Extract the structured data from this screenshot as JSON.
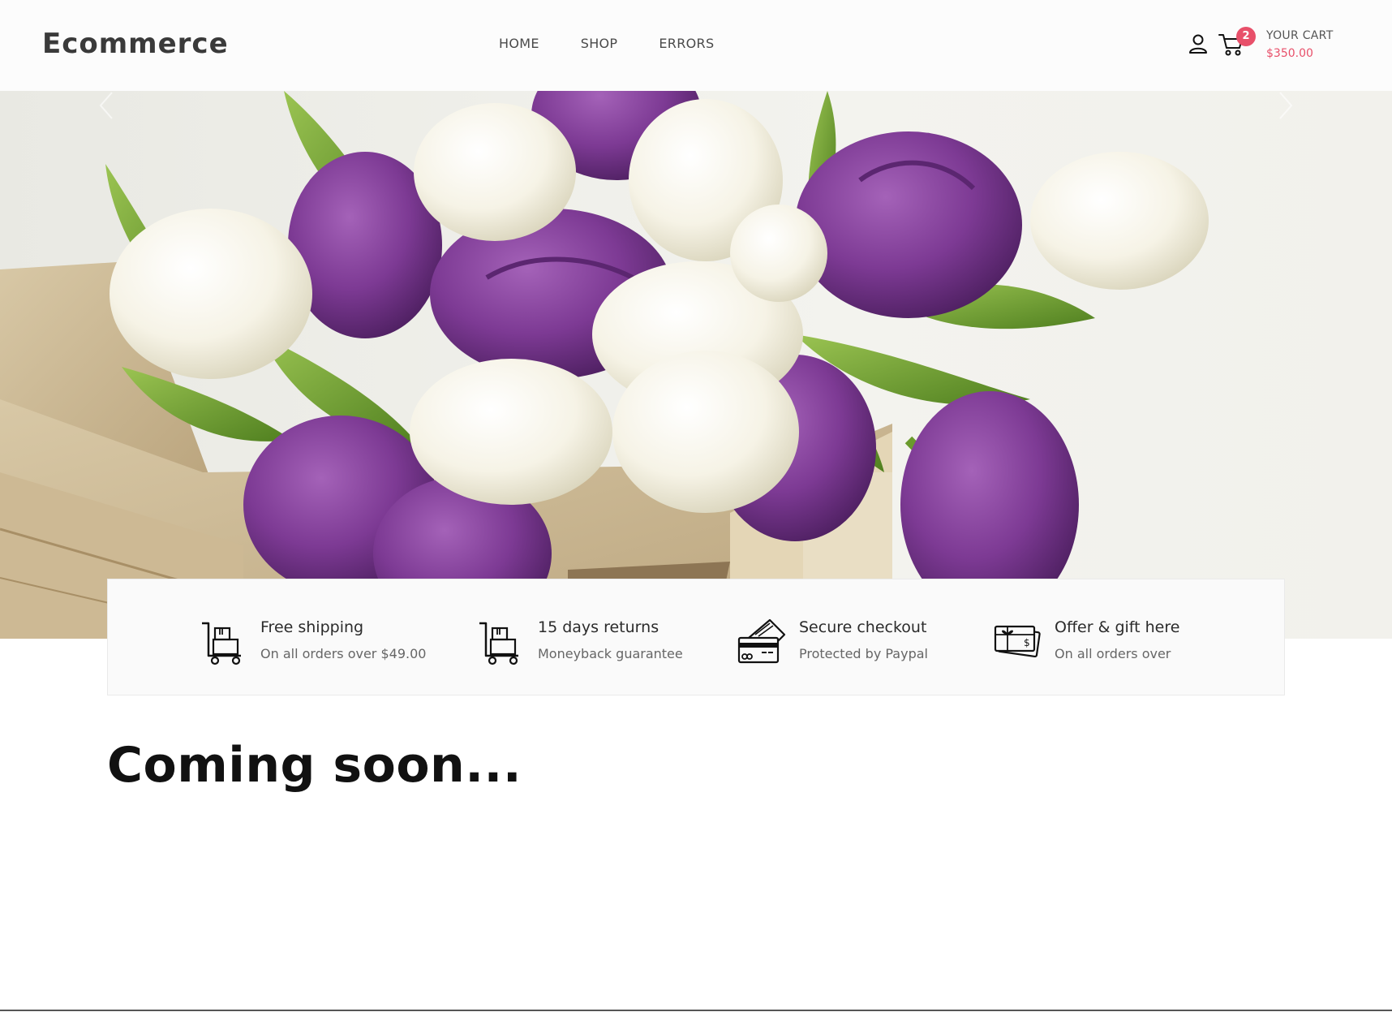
{
  "header": {
    "logo": "Ecommerce",
    "nav": [
      "HOME",
      "SHOP",
      "ERRORS"
    ],
    "cart_count": "2",
    "cart_label": "YOUR CART",
    "cart_total": "$350.00"
  },
  "features": [
    {
      "title": "Free shipping",
      "subtitle": "On all orders over $49.00",
      "icon": "trolley-icon"
    },
    {
      "title": "15 days returns",
      "subtitle": "Moneyback guarantee",
      "icon": "trolley-icon"
    },
    {
      "title": "Secure checkout",
      "subtitle": "Protected by Paypal",
      "icon": "credit-card-icon"
    },
    {
      "title": "Offer & gift here",
      "subtitle": "On all orders over",
      "icon": "gift-card-icon"
    }
  ],
  "main": {
    "heading": "Coming soon..."
  },
  "colors": {
    "accent": "#e8506a",
    "tulip_purple": "#7d3a94",
    "tulip_white": "#f3f0e0",
    "leaf_green": "#6a9a2c"
  }
}
